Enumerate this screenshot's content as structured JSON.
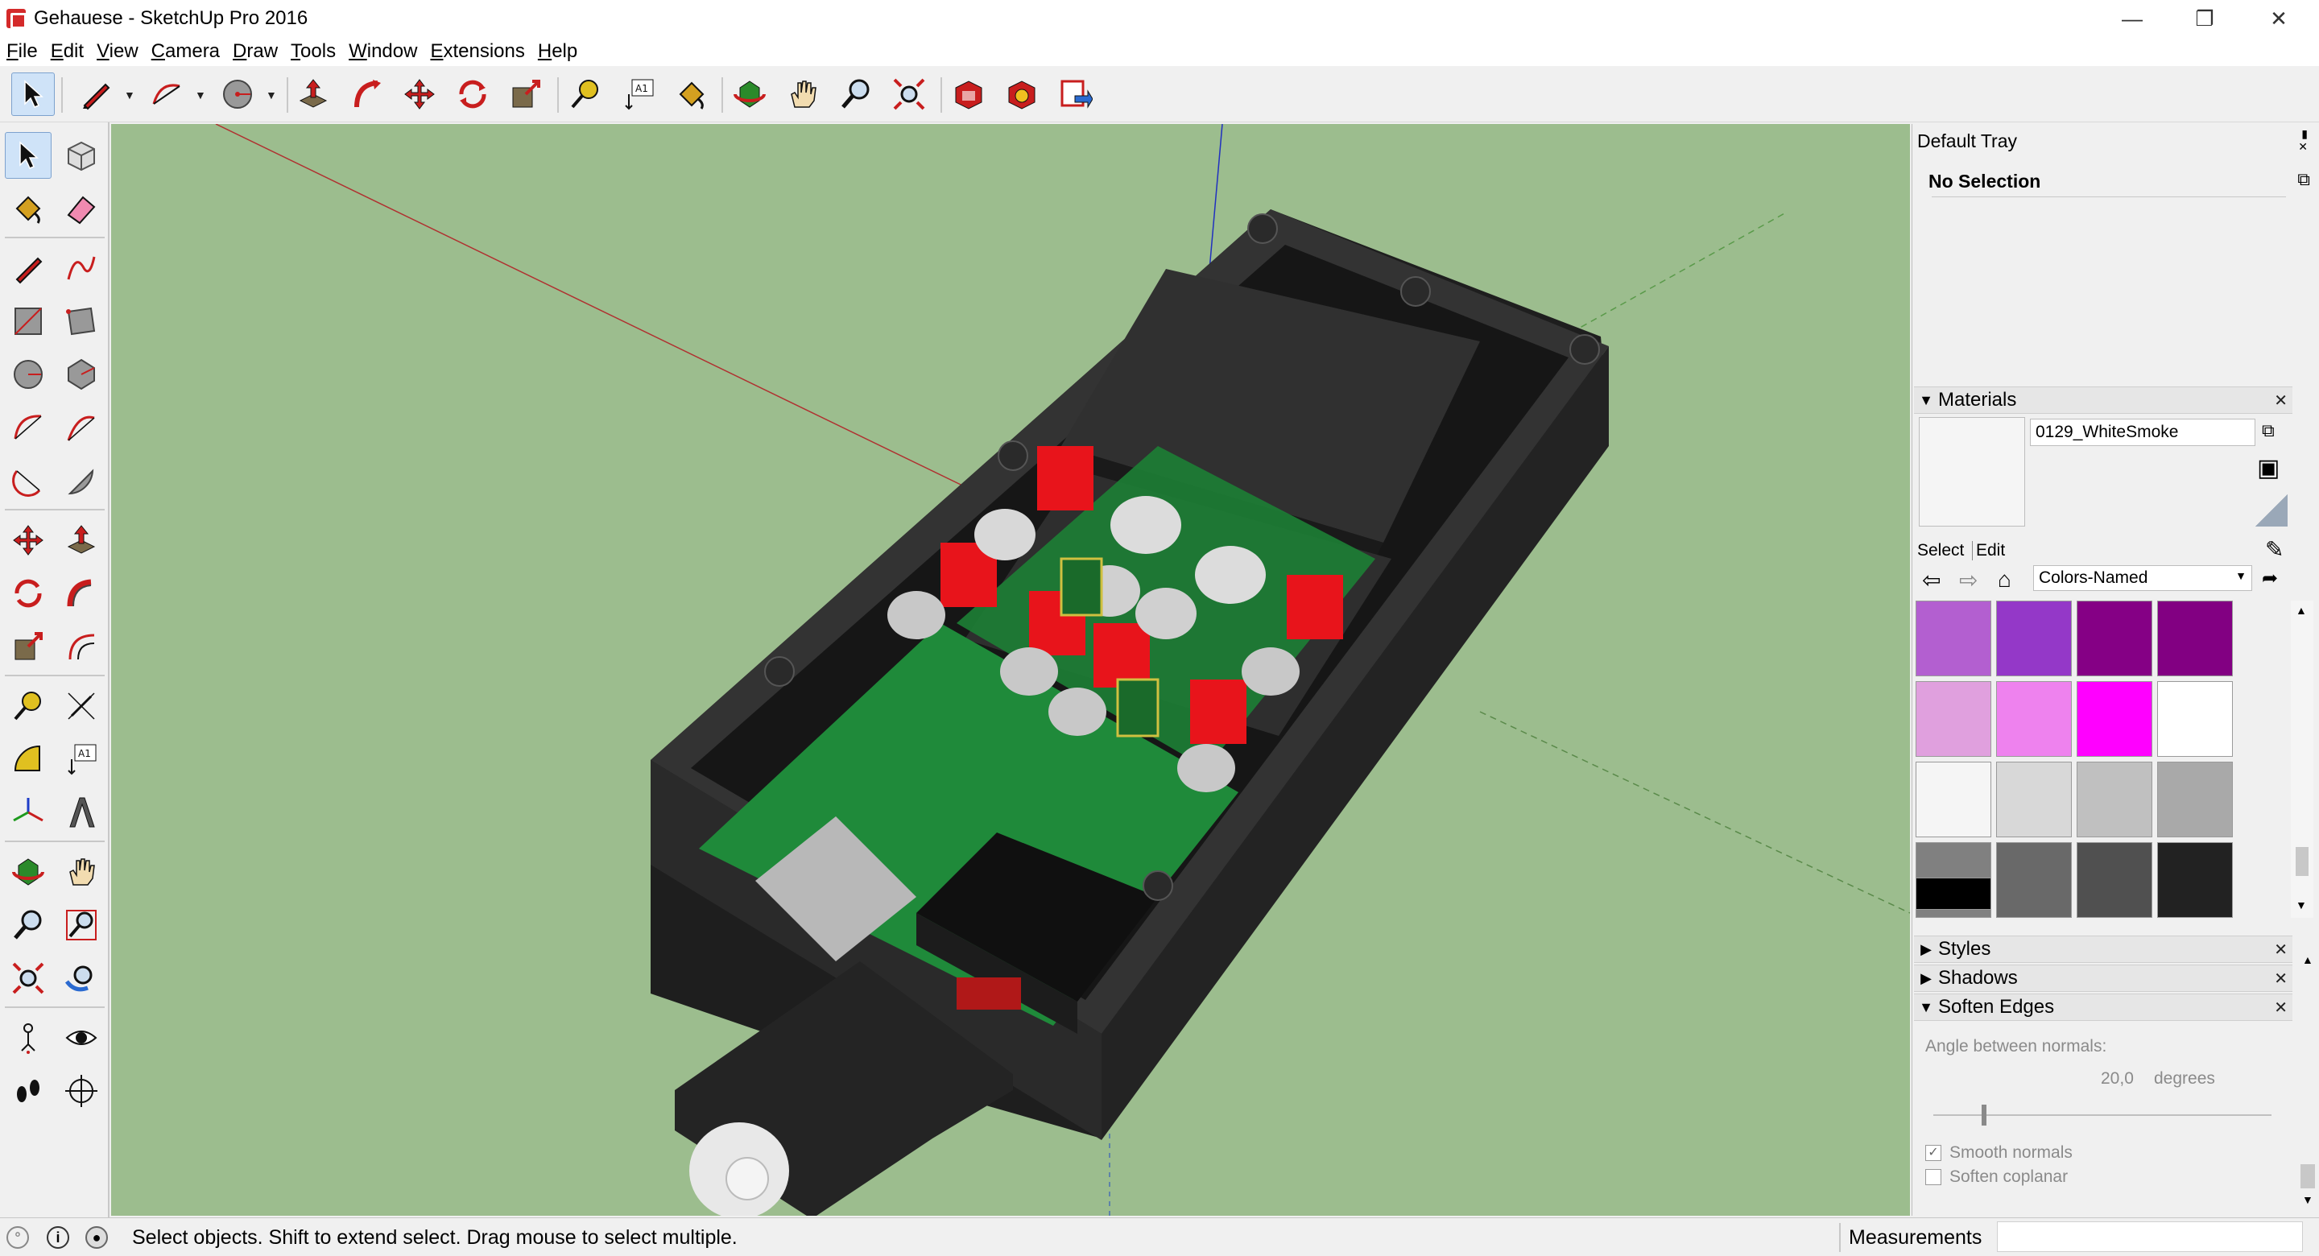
{
  "window": {
    "title": "Gehauese - SketchUp Pro 2016"
  },
  "menu": [
    "File",
    "Edit",
    "View",
    "Camera",
    "Draw",
    "Tools",
    "Window",
    "Extensions",
    "Help"
  ],
  "toolbar_icons": [
    "select-icon",
    "pencil-icon",
    "arc-icon",
    "circle-icon",
    "push-pull-icon",
    "follow-me-icon",
    "move-icon",
    "rotate-icon",
    "scale-icon",
    "tape-measure-icon",
    "text-icon",
    "paint-bucket-icon",
    "orbit-icon",
    "pan-icon",
    "zoom-icon",
    "zoom-extents-icon",
    "3d-warehouse-icon",
    "extension-warehouse-icon",
    "layout-send-icon"
  ],
  "left_tools": {
    "text_label": "A1"
  },
  "tray": {
    "title": "Default Tray",
    "entity_info": {
      "label": "No Selection"
    },
    "materials": {
      "header": "Materials",
      "material_name": "0129_WhiteSmoke",
      "tab_select": "Select",
      "tab_edit": "Edit",
      "library": "Colors-Named",
      "swatches": [
        "#b35fd0",
        "#9438c8",
        "#850085",
        "#820082",
        "#e0a0de",
        "#ee82ee",
        "#ff00ff",
        "#ffffff",
        "#f5f5f5",
        "#d8d8d8",
        "#c0c0c0",
        "#a9a9a9",
        "#808080",
        "#696969",
        "#505050",
        "#222222",
        "#000000"
      ]
    },
    "panels": {
      "styles": "Styles",
      "shadows": "Shadows",
      "soften_edges": "Soften Edges"
    },
    "soften": {
      "angle_label": "Angle between normals:",
      "angle_value": "20,0",
      "angle_unit": "degrees",
      "smooth_normals": "Smooth normals",
      "soften_coplanar": "Soften coplanar",
      "smooth_normals_checked": true,
      "soften_coplanar_checked": false
    }
  },
  "status": {
    "message": "Select objects. Shift to extend select. Drag mouse to select multiple.",
    "measurements_label": "Measurements"
  },
  "colors": {
    "viewport_bg": "#9cbd8e",
    "enclosure": "#2b2b2b",
    "pcb": "#1f8a3a",
    "capacitor_red": "#e8141b"
  }
}
